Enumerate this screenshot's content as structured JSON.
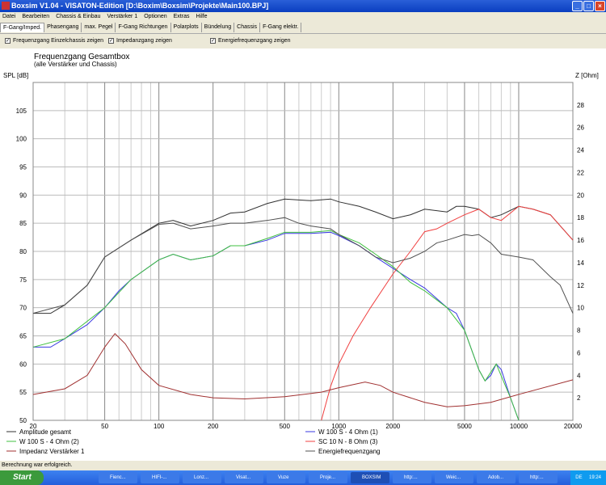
{
  "window": {
    "title": "Boxsim V1.04 - VISATON-Edition [D:\\Boxim\\Boxsim\\Projekte\\Main100.BPJ]"
  },
  "menu": [
    "Datei",
    "Bearbeiten",
    "Chassis & Einbau",
    "Verstärker 1",
    "Optionen",
    "Extras",
    "Hilfe"
  ],
  "tabs": [
    "F-Gang/Imped.",
    "Phasengang",
    "max. Pegel",
    "F-Gang Richtungen",
    "Polarplots",
    "Bündelung",
    "Chassis",
    "F-Gang elektr."
  ],
  "options": [
    "Frequenzgang Einzelchassis zeigen",
    "Impedanzgang zeigen",
    "Energiefrequenzgang zeigen"
  ],
  "status": "Berechnung war erfolgreich.",
  "taskbar": {
    "start": "Start",
    "items": [
      "Fienc...",
      "HIFI-...",
      "Lonz...",
      "Visat...",
      "Vuze",
      "Proje...",
      "BOXSIM",
      "http:...",
      "Weic...",
      "Adob...",
      "http:..."
    ],
    "lang": "DE",
    "time": "19:24"
  },
  "chart_data": {
    "type": "line",
    "title": "Frequenzgang Gesamtbox",
    "subtitle": "(alle Verstärker und Chassis)",
    "ylabel": "SPL [dB]",
    "y2label": "Z [Ohm]",
    "xscale": "log",
    "xlim": [
      20,
      20000
    ],
    "ylim": [
      50,
      110
    ],
    "y2lim": [
      0,
      30
    ],
    "xticks": [
      20,
      50,
      100,
      200,
      500,
      1000,
      2000,
      5000,
      10000,
      20000
    ],
    "yticks": [
      50,
      55,
      60,
      65,
      70,
      75,
      80,
      85,
      90,
      95,
      100,
      105
    ],
    "y2ticks": [
      2,
      4,
      6,
      8,
      10,
      12,
      14,
      16,
      18,
      20,
      22,
      24,
      26,
      28
    ],
    "series": [
      {
        "name": "Amplitude gesamt",
        "color": "#303030",
        "axis": "y",
        "points": [
          [
            20,
            69
          ],
          [
            25,
            69
          ],
          [
            30,
            70.5
          ],
          [
            40,
            74
          ],
          [
            50,
            79
          ],
          [
            70,
            82
          ],
          [
            100,
            85
          ],
          [
            120,
            85.5
          ],
          [
            150,
            84.5
          ],
          [
            200,
            85.5
          ],
          [
            250,
            86.8
          ],
          [
            300,
            87
          ],
          [
            400,
            88.5
          ],
          [
            500,
            89.3
          ],
          [
            700,
            89
          ],
          [
            900,
            89.3
          ],
          [
            1000,
            88.8
          ],
          [
            1300,
            88
          ],
          [
            1600,
            87
          ],
          [
            2000,
            85.8
          ],
          [
            2500,
            86.5
          ],
          [
            3000,
            87.5
          ],
          [
            4000,
            87
          ],
          [
            4500,
            88
          ],
          [
            5000,
            88
          ],
          [
            6000,
            87.5
          ],
          [
            7000,
            86
          ],
          [
            8000,
            86.5
          ],
          [
            10000,
            88
          ],
          [
            12000,
            87.5
          ],
          [
            15000,
            86.5
          ],
          [
            20000,
            82
          ]
        ]
      },
      {
        "name": "W 100 S - 4 Ohm (1)",
        "color": "#3a3ae0",
        "axis": "y",
        "points": [
          [
            20,
            63
          ],
          [
            25,
            63
          ],
          [
            30,
            64.5
          ],
          [
            40,
            67
          ],
          [
            50,
            70
          ],
          [
            60,
            73
          ],
          [
            70,
            75
          ],
          [
            100,
            78.5
          ],
          [
            120,
            79.5
          ],
          [
            150,
            78.5
          ],
          [
            200,
            79.2
          ],
          [
            250,
            81
          ],
          [
            300,
            81
          ],
          [
            400,
            82
          ],
          [
            500,
            83.2
          ],
          [
            700,
            83.2
          ],
          [
            900,
            83.4
          ],
          [
            1000,
            82.8
          ],
          [
            1300,
            81
          ],
          [
            1600,
            79
          ],
          [
            2000,
            77
          ],
          [
            2500,
            75
          ],
          [
            3000,
            73.5
          ],
          [
            4000,
            70
          ],
          [
            4500,
            69
          ],
          [
            5000,
            66
          ],
          [
            6000,
            59
          ],
          [
            6500,
            57
          ],
          [
            7000,
            58
          ],
          [
            7500,
            60
          ],
          [
            8000,
            59
          ],
          [
            9000,
            54
          ],
          [
            10000,
            50
          ]
        ]
      },
      {
        "name": "W 100 S - 4 Ohm (2)",
        "color": "#40c040",
        "axis": "y",
        "points": [
          [
            20,
            63
          ],
          [
            30,
            64.5
          ],
          [
            50,
            70
          ],
          [
            70,
            75
          ],
          [
            100,
            78.5
          ],
          [
            120,
            79.5
          ],
          [
            150,
            78.5
          ],
          [
            200,
            79.2
          ],
          [
            250,
            81
          ],
          [
            300,
            81
          ],
          [
            400,
            82.3
          ],
          [
            500,
            83.4
          ],
          [
            700,
            83.4
          ],
          [
            900,
            83.7
          ],
          [
            1000,
            83
          ],
          [
            1300,
            81.5
          ],
          [
            1600,
            79.5
          ],
          [
            2000,
            77.3
          ],
          [
            2500,
            74.5
          ],
          [
            3000,
            73
          ],
          [
            4000,
            70
          ],
          [
            5000,
            66
          ],
          [
            6000,
            59
          ],
          [
            6500,
            57
          ],
          [
            7500,
            60
          ],
          [
            9000,
            54
          ],
          [
            10000,
            50
          ]
        ]
      },
      {
        "name": "SC 10 N - 8 Ohm (3)",
        "color": "#f04040",
        "axis": "y",
        "points": [
          [
            800,
            50
          ],
          [
            900,
            56
          ],
          [
            1000,
            60
          ],
          [
            1200,
            65
          ],
          [
            1500,
            70
          ],
          [
            2000,
            76
          ],
          [
            2500,
            80
          ],
          [
            3000,
            83.5
          ],
          [
            3500,
            84
          ],
          [
            4000,
            85
          ],
          [
            5000,
            86.5
          ],
          [
            6000,
            87.5
          ],
          [
            7000,
            86
          ],
          [
            8000,
            85.5
          ],
          [
            10000,
            88
          ],
          [
            12000,
            87.5
          ],
          [
            15000,
            86.5
          ],
          [
            20000,
            82
          ]
        ]
      },
      {
        "name": "Impedanz Verstärker 1",
        "color": "#a03030",
        "axis": "y2",
        "points": [
          [
            20,
            2.3
          ],
          [
            30,
            2.8
          ],
          [
            40,
            4
          ],
          [
            50,
            6.5
          ],
          [
            57,
            7.7
          ],
          [
            65,
            6.8
          ],
          [
            80,
            4.5
          ],
          [
            100,
            3.1
          ],
          [
            150,
            2.3
          ],
          [
            200,
            2
          ],
          [
            300,
            1.9
          ],
          [
            500,
            2.1
          ],
          [
            800,
            2.5
          ],
          [
            1000,
            2.9
          ],
          [
            1400,
            3.4
          ],
          [
            1700,
            3.1
          ],
          [
            2000,
            2.5
          ],
          [
            3000,
            1.6
          ],
          [
            4000,
            1.2
          ],
          [
            5000,
            1.3
          ],
          [
            7000,
            1.6
          ],
          [
            10000,
            2.3
          ],
          [
            20000,
            3.6
          ]
        ]
      },
      {
        "name": "Energiefrequenzgang",
        "color": "#505050",
        "axis": "y",
        "points": [
          [
            20,
            69
          ],
          [
            30,
            70.5
          ],
          [
            40,
            74
          ],
          [
            50,
            79
          ],
          [
            70,
            82
          ],
          [
            100,
            84.8
          ],
          [
            120,
            85
          ],
          [
            150,
            84
          ],
          [
            200,
            84.5
          ],
          [
            250,
            85
          ],
          [
            300,
            85
          ],
          [
            400,
            85.5
          ],
          [
            500,
            86
          ],
          [
            600,
            85
          ],
          [
            700,
            84.5
          ],
          [
            900,
            84
          ],
          [
            1000,
            83
          ],
          [
            1300,
            81
          ],
          [
            1600,
            79
          ],
          [
            2000,
            78
          ],
          [
            2500,
            78.8
          ],
          [
            3000,
            80
          ],
          [
            3500,
            81.5
          ],
          [
            4000,
            82
          ],
          [
            5000,
            83
          ],
          [
            5500,
            82.8
          ],
          [
            6000,
            83
          ],
          [
            7000,
            81.5
          ],
          [
            8000,
            79.5
          ],
          [
            10000,
            79
          ],
          [
            12000,
            78.5
          ],
          [
            15000,
            75.5
          ],
          [
            17000,
            74
          ],
          [
            20000,
            69
          ]
        ]
      }
    ]
  }
}
